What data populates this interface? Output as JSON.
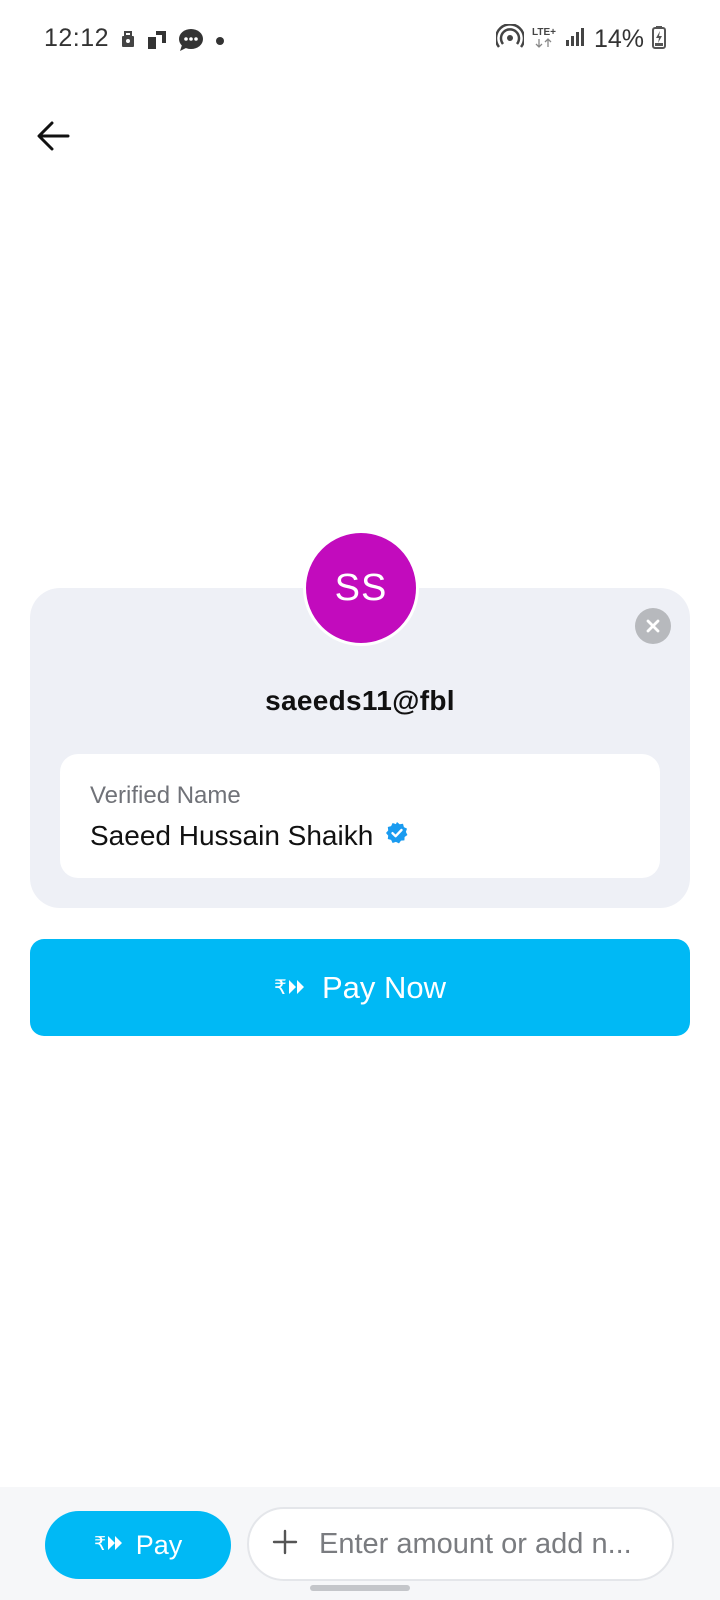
{
  "status_bar": {
    "time": "12:12",
    "network": "LTE+",
    "battery": "14%"
  },
  "contact": {
    "initials": "SS",
    "avatar_color": "#c20bbd",
    "upi_id": "saeeds11@fbl",
    "verified_label": "Verified Name",
    "verified_name": "Saeed Hussain Shaikh"
  },
  "actions": {
    "pay_now_label": "Pay Now",
    "pay_label": "Pay",
    "amount_placeholder": "Enter amount or add n..."
  },
  "colors": {
    "accent": "#00b9f5",
    "card_bg": "#eef0f6",
    "verified_badge": "#1a9bf0"
  }
}
